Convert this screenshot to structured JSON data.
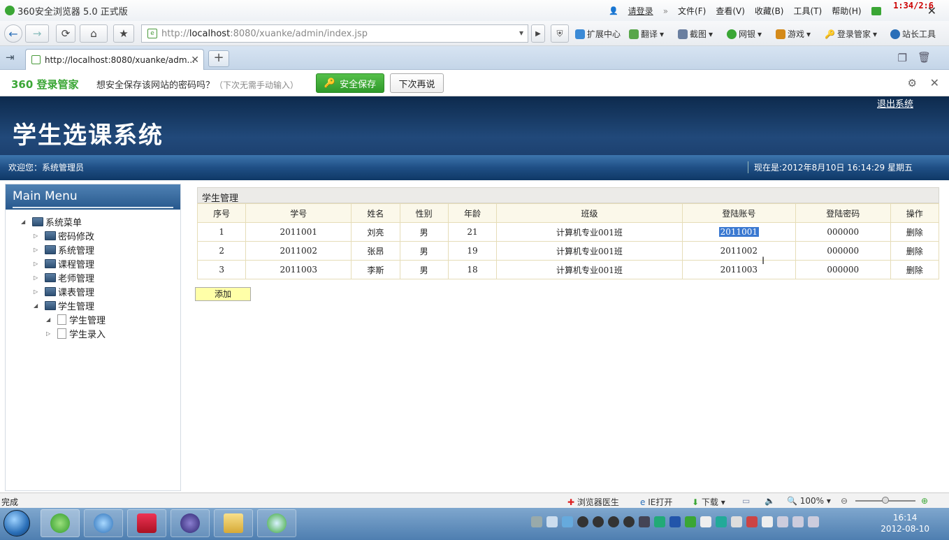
{
  "browser": {
    "title": "360安全浏览器 5.0 正式版",
    "login_link": "请登录",
    "menus": [
      "文件(F)",
      "查看(V)",
      "收藏(B)",
      "工具(T)",
      "帮助(H)"
    ],
    "overlay_clock": "1:34/2:6",
    "url_prefix": "http://",
    "url_host": "localhost",
    "url_rest": ":8080/xuanke/admin/index.jsp",
    "toolbar": {
      "extensions": "扩展中心",
      "translate": "翻译",
      "screenshot": "截图",
      "bank": "网银",
      "games": "游戏",
      "login_manager": "登录管家",
      "webmaster": "站长工具"
    },
    "tab_title": "http://localhost:8080/xuanke/adm...",
    "pwbar": {
      "logo": "360 登录管家",
      "message": "想安全保存该网站的密码吗？",
      "hint": "（下次无需手动输入）",
      "save": "安全保存",
      "later": "下次再说"
    }
  },
  "app": {
    "system_title": "学生选课系统",
    "logout": "退出系统",
    "welcome": "欢迎您：系统管理员",
    "now": "现在是:2012年8月10日  16:14:29 星期五",
    "menu_title": "Main Menu",
    "tree": {
      "root": "系统菜单",
      "items": [
        "密码修改",
        "系统管理",
        "课程管理",
        "老师管理",
        "课表管理",
        "学生管理"
      ],
      "sub": [
        "学生管理",
        "学生录入"
      ]
    },
    "panel_title": "学生管理",
    "columns": [
      "序号",
      "学号",
      "姓名",
      "性别",
      "年龄",
      "班级",
      "登陆账号",
      "登陆密码",
      "操作"
    ],
    "rows": [
      {
        "no": "1",
        "sid": "2011001",
        "name": "刘亮",
        "sex": "男",
        "age": "21",
        "cls": "计算机专业001班",
        "account": "2011001",
        "password": "000000",
        "op": "删除"
      },
      {
        "no": "2",
        "sid": "2011002",
        "name": "张昂",
        "sex": "男",
        "age": "19",
        "cls": "计算机专业001班",
        "account": "2011002",
        "password": "000000",
        "op": "删除"
      },
      {
        "no": "3",
        "sid": "2011003",
        "name": "李斯",
        "sex": "男",
        "age": "18",
        "cls": "计算机专业001班",
        "account": "2011003",
        "password": "000000",
        "op": "删除"
      }
    ],
    "add_button": "添加"
  },
  "statusbar": {
    "status": "完成",
    "doctor": "浏览器医生",
    "ie_open": "IE打开",
    "download": "下载",
    "zoom": "100%"
  },
  "taskbar": {
    "time": "16:14",
    "date": "2012-08-10"
  }
}
